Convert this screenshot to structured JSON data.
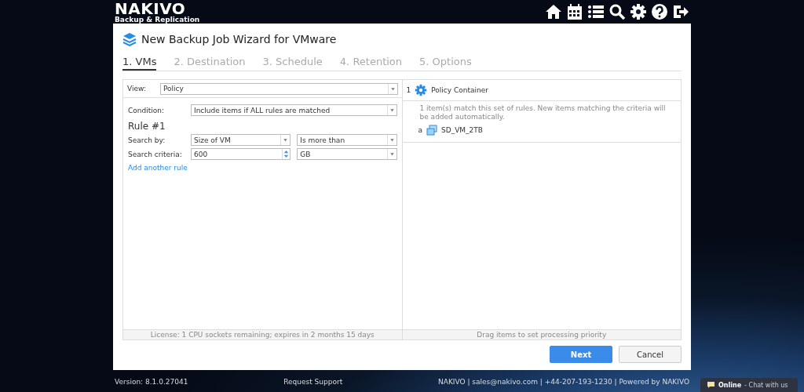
{
  "logo": {
    "name": "NAKIVO",
    "tagline": "Backup & Replication"
  },
  "toolbar": [
    {
      "kind": "home"
    },
    {
      "kind": "calendar"
    },
    {
      "kind": "list"
    },
    {
      "kind": "search"
    },
    {
      "kind": "settings"
    },
    {
      "kind": "help"
    },
    {
      "kind": "logout"
    }
  ],
  "wizard": {
    "title": "New Backup Job Wizard for VMware",
    "tabs": [
      {
        "label": "1. VMs",
        "selected": true
      },
      {
        "label": "2. Destination",
        "selected": false
      },
      {
        "label": "3. Schedule",
        "selected": false
      },
      {
        "label": "4. Retention",
        "selected": false
      },
      {
        "label": "5. Options",
        "selected": false
      }
    ],
    "left_panel": {
      "view": {
        "label": "View:",
        "value": "Policy"
      },
      "condition": {
        "label": "Condition:",
        "value": "Include items if ALL rules are matched"
      },
      "rule": {
        "title": "Rule #1",
        "search_by": {
          "label": "Search by:",
          "value": "Size of VM",
          "operator": "Is more than"
        },
        "search_criteria": {
          "label": "Search criteria:",
          "value": "600",
          "unit": "GB"
        }
      },
      "add_rule_link": "Add another rule",
      "footer": "License: 1 CPU sockets remaining; expires in 2 months 15 days"
    },
    "right_panel": {
      "container": {
        "index": "1",
        "name": "Policy Container"
      },
      "note": "1 item(s) match this set of rules. New items matching the criteria will be added automatically.",
      "items": [
        {
          "prefix": "a",
          "name": "SD_VM_2TB"
        }
      ],
      "footer": "Drag items to set processing priority"
    },
    "buttons": [
      {
        "label": "Next",
        "kind": "primary"
      },
      {
        "label": "Cancel",
        "kind": "secondary"
      }
    ]
  },
  "footer": {
    "version": "Version: 8.1.0.27041",
    "support": "Request Support",
    "contact": "NAKIVO | sales@nakivo.com | +44-207-193-1230 | Powered by NAKIVO"
  },
  "chat": {
    "status": "Online",
    "text": "- Chat with us"
  }
}
